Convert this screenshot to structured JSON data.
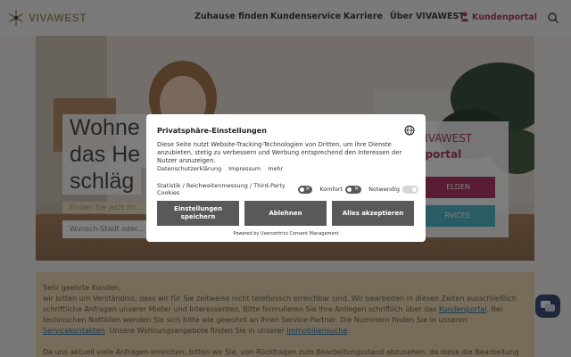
{
  "header": {
    "logo_text": "VIVAWEST",
    "nav": [
      "Zuhause finden",
      "Kundenservice",
      "Karriere",
      "Über VIVAWEST"
    ],
    "portal_label": "Kundenportal"
  },
  "hero": {
    "title_lines": [
      "Wohne",
      "das He",
      "schläg"
    ],
    "tagline": "Finden Sie jetzt ihr ...",
    "search_placeholder": "Wunsch-Stadt oder...",
    "portal_title_1": "VIVAWEST",
    "portal_title_2": "nportal",
    "portal_btn_1": "ELDEN",
    "portal_btn_2": "RVICES"
  },
  "notice": {
    "greeting": "Sehr geehrte Kunden,",
    "line1": "wir bitten um Verständnis, dass wir für Sie zeitweise nicht telefonisch erreichbar sind. Wir bearbeiten in diesen Zeiten ausschließlich",
    "line2_pre": "schriftliche Anfragen unserer Mieter und Interessenten. Bitte formulieren Sie Ihre Anliegen schriftlich über das ",
    "line2_link": "Kundenportal",
    "line2_post": ". Bei",
    "line3": "technischen Notfällen wenden Sie sich bitte wie gewohnt an Ihren Service-Partner. Die Nummern finden Sie in unseren",
    "line4_link1": "Servicekontakten",
    "line4_mid": ". Unsere Wohnungsangebote finden Sie in unserer ",
    "line4_link2": "Immobiliensuche",
    "line4_post": ".",
    "line5": "Da uns aktuell viele Anfragen erreichen, bitten wir Sie, von Rückfragen zum Bearbeitungsstand abzusehen, da diese die Bearbeitung"
  },
  "consent": {
    "title": "Privatsphäre-Einstellungen",
    "text": "Diese Seite nutzt Website-Tracking-Technologien von Dritten, um ihre Dienste anzubieten, stetig zu verbessern und Werbung entsprechend den Interessen der Nutzer anzuzeigen.",
    "links": [
      "Datenschutzerklärung",
      "Impressum",
      "mehr"
    ],
    "toggles": [
      {
        "label": "Statistik / Reichweitenmessung / Third-Party Cookies",
        "state": "off"
      },
      {
        "label": "Komfort",
        "state": "off"
      },
      {
        "label": "Notwendig",
        "state": "on-disabled"
      }
    ],
    "btn_settings": "Einstellungen speichern",
    "btn_reject": "Ablehnen",
    "btn_accept": "Alles akzeptieren",
    "footer": "Powered by Usercentrics Consent Management"
  },
  "colors": {
    "brand_gold": "#a99a6f",
    "brand_magenta": "#b03a6b",
    "button_grey": "#595959"
  }
}
